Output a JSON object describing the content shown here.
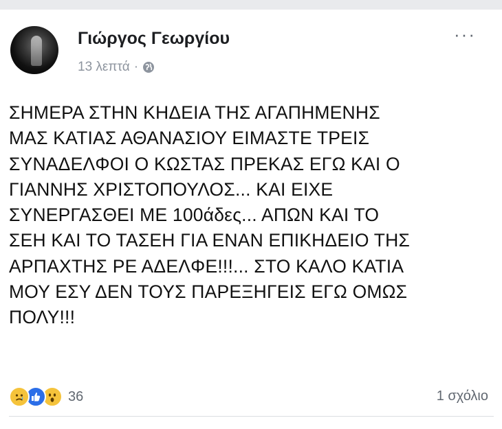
{
  "post": {
    "author": "Γιώργος Γεωργίου",
    "time": "13 λεπτά",
    "time_separator": "·",
    "more_label": "···",
    "body_lines": [
      "ΣΗΜΕΡΑ ΣΤΗΝ ΚΗΔΕΙΑ ΤΗΣ ΑΓΑΠΗΜΕΝΗΣ",
      "ΜΑΣ ΚΑΤΙΑΣ ΑΘΑΝΑΣΙΟΥ ΕΙΜΑΣΤΕ ΤΡΕΙΣ",
      "ΣΥΝΑΔΕΛΦΟΙ Ο ΚΩΣΤΑΣ ΠΡΕΚΑΣ ΕΓΩ ΚΑΙ Ο",
      "ΓΙΑΝΝΗΣ ΧΡΙΣΤΟΠΟΥΛΟΣ... ΚΑΙ ΕΙΧΕ",
      "ΣΥΝΕΡΓΑΣΘΕΙ ΜΕ 100άδες... ΑΠΩΝ ΚΑΙ ΤΟ",
      "ΣΕΗ ΚΑΙ ΤΟ ΤΑΣΕΗ ΓΙΑ ΕΝΑΝ ΕΠΙΚΗΔΕΙΟ ΤΗΣ",
      "ΑΡΠΑΧΤΗΣ ΡΕ ΑΔΕΛΦΕ!!!... ΣΤΟ ΚΑΛΟ ΚΑΤΙΑ",
      "ΜΟΥ ΕΣΥ ΔΕΝ ΤΟΥΣ ΠΑΡΕΞΗΓΕΙΣ ΕΓΩ ΟΜΩΣ",
      "ΠΟΛΥ!!!"
    ],
    "reactions": {
      "icons": [
        "sad-reaction-icon",
        "like-reaction-icon",
        "wow-reaction-icon"
      ],
      "count": "36"
    },
    "comments_label": "1 σχόλιο"
  },
  "colors": {
    "text": "#1c1e21",
    "meta": "#8d949e",
    "like_blue": "#2b6ee8",
    "reaction_yellow": "#f5c33b",
    "page_bg": "#e9eaed"
  }
}
